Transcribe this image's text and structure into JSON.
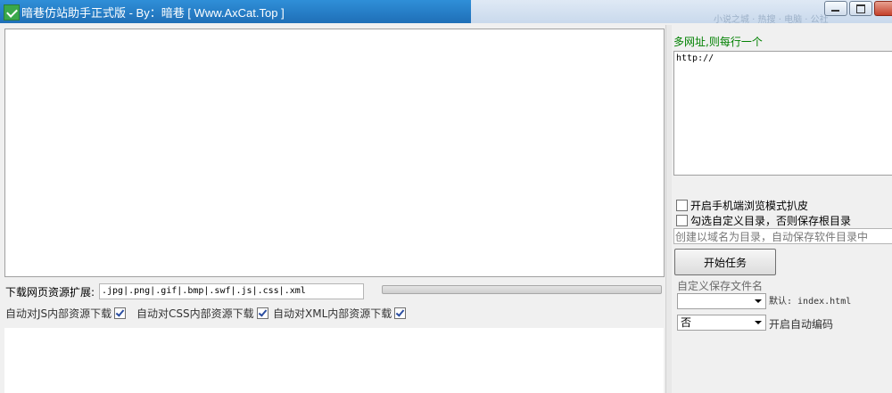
{
  "window": {
    "title": "暗巷仿站助手正式版 - By：暗巷 [ Www.AxCat.Top ]",
    "background_ghost_text": "小说之城 · 热搜 · 电脑 · 公社"
  },
  "left": {
    "ext_label": "下载网页资源扩展:",
    "ext_value": ".jpg|.png|.gif|.bmp|.swf|.js|.css|.xml",
    "options": [
      {
        "label": "自动对JS内部资源下载",
        "checked": true
      },
      {
        "label": "自动对CSS内部资源下载",
        "checked": true
      },
      {
        "label": "自动对XML内部资源下载",
        "checked": true
      }
    ],
    "progress": 0
  },
  "right": {
    "url_hint": "多网址,则每行一个",
    "url_value": "http://",
    "mobile_mode": {
      "label": "开启手机端浏览模式扒皮",
      "checked": false
    },
    "custom_dir": {
      "label": "勾选自定义目录，否则保存根目录",
      "checked": false
    },
    "domain_placeholder": "创建以域名为目录，自动保存软件目录中",
    "start_button": "开始任务",
    "filename_label": "自定义保存文件名",
    "filename_select_value": "",
    "filename_default": "默认: index.html",
    "encode_select_value": "否",
    "encode_label": "开启自动编码"
  }
}
